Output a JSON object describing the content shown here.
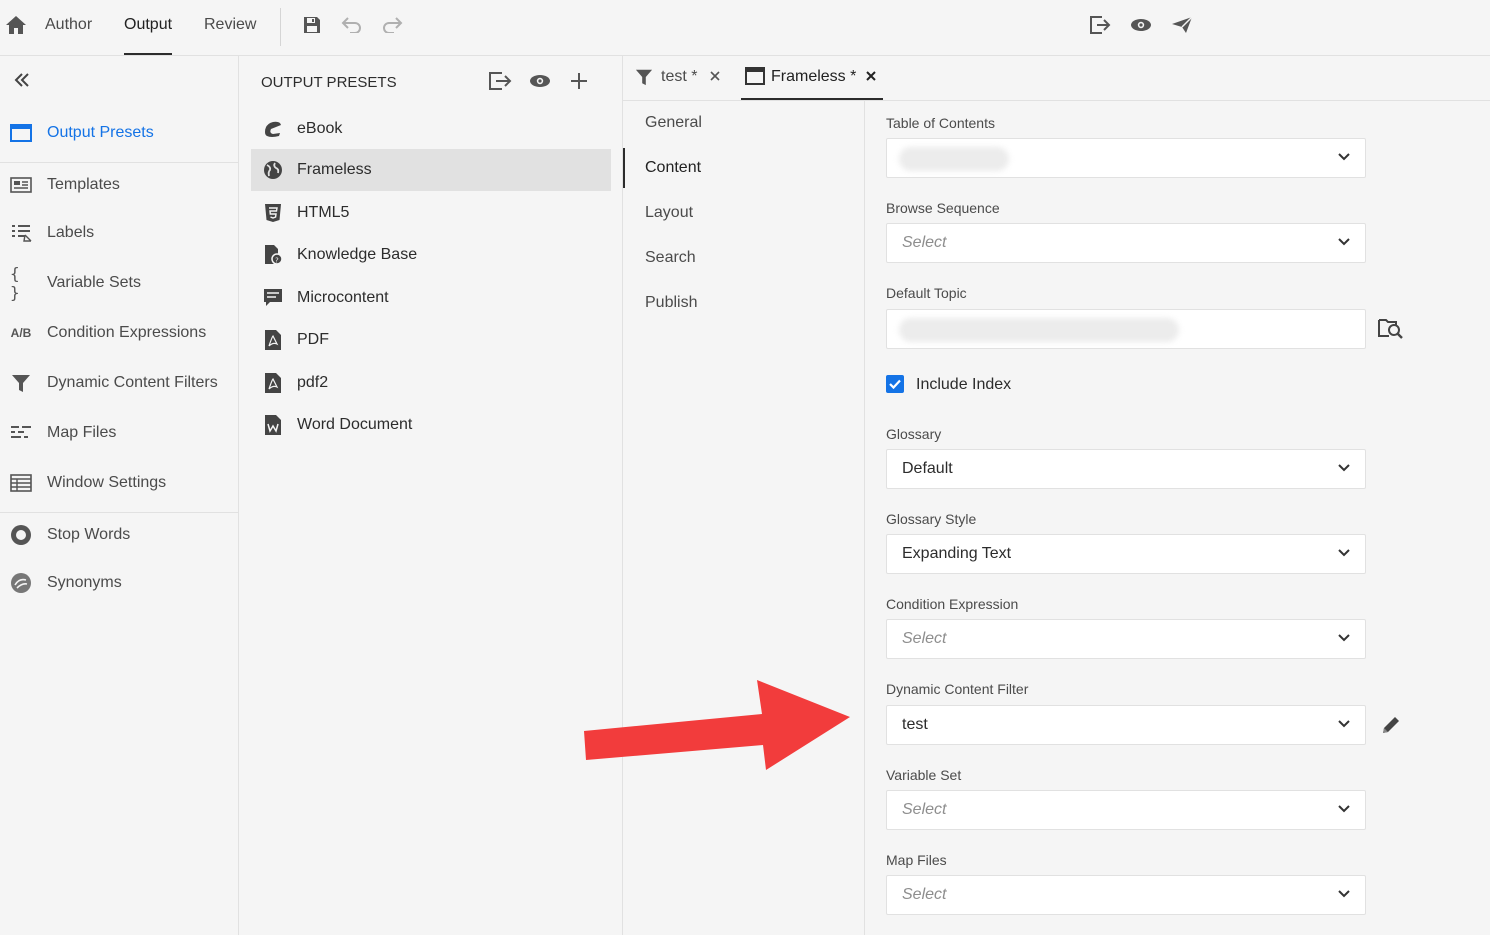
{
  "topbar": {
    "tabs": [
      "Author",
      "Output",
      "Review"
    ],
    "active_tab": "Output"
  },
  "sidebar": {
    "items": [
      {
        "label": "Output Presets",
        "icon": "output-presets-icon"
      },
      {
        "label": "Templates",
        "icon": "templates-icon"
      },
      {
        "label": "Labels",
        "icon": "labels-icon"
      },
      {
        "label": "Variable Sets",
        "icon": "braces-icon"
      },
      {
        "label": "Condition Expressions",
        "icon": "ab-icon",
        "icon_text": "A/B"
      },
      {
        "label": "Dynamic Content Filters",
        "icon": "filter-icon"
      },
      {
        "label": "Map Files",
        "icon": "map-files-icon"
      },
      {
        "label": "Window Settings",
        "icon": "window-settings-icon"
      },
      {
        "label": "Stop Words",
        "icon": "stop-words-icon"
      },
      {
        "label": "Synonyms",
        "icon": "synonyms-icon"
      }
    ],
    "active": "Output Presets",
    "braces_glyph": "{ }"
  },
  "presets": {
    "heading": "OUTPUT PRESETS",
    "items": [
      {
        "label": "eBook",
        "icon": "ebook-icon"
      },
      {
        "label": "Frameless",
        "icon": "globe-icon"
      },
      {
        "label": "HTML5",
        "icon": "html5-icon"
      },
      {
        "label": "Knowledge Base",
        "icon": "knowledge-base-icon"
      },
      {
        "label": "Microcontent",
        "icon": "microcontent-icon"
      },
      {
        "label": "PDF",
        "icon": "pdf-icon"
      },
      {
        "label": "pdf2",
        "icon": "pdf-icon"
      },
      {
        "label": "Word Document",
        "icon": "word-icon"
      }
    ],
    "selected": "Frameless"
  },
  "editor_tabs": [
    {
      "label": "test *",
      "icon": "filter-icon"
    },
    {
      "label": "Frameless *",
      "icon": "window-icon"
    }
  ],
  "sections": [
    "General",
    "Content",
    "Layout",
    "Search",
    "Publish"
  ],
  "active_section": "Content",
  "form": {
    "toc_label": "Table of Contents",
    "browse_label": "Browse Sequence",
    "browse_value": "Select",
    "default_topic_label": "Default Topic",
    "include_index_label": "Include Index",
    "include_index_checked": true,
    "glossary_label": "Glossary",
    "glossary_value": "Default",
    "glossary_style_label": "Glossary Style",
    "glossary_style_value": "Expanding Text",
    "condition_label": "Condition Expression",
    "condition_value": "Select",
    "dcf_label": "Dynamic Content Filter",
    "dcf_value": "test",
    "variable_set_label": "Variable Set",
    "variable_set_value": "Select",
    "map_files_label": "Map Files",
    "map_files_value": "Select"
  },
  "colors": {
    "accent": "#1473e6",
    "arrow": "#f23c3c",
    "selected_bg": "#e1e1e1"
  }
}
